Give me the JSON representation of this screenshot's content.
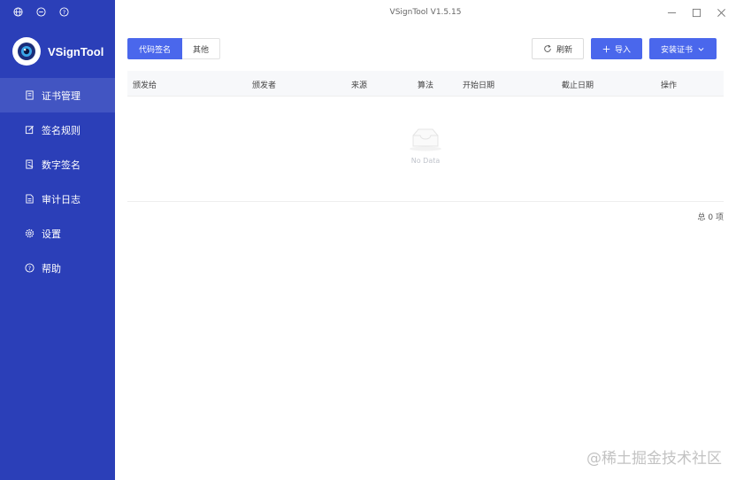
{
  "window": {
    "title": "VSignTool V1.5.15"
  },
  "sidebar": {
    "top_icons": [
      "globe-icon",
      "chat-icon",
      "help-circle-icon"
    ],
    "brand": {
      "name": "VSignTool",
      "icon": "eye-logo-icon"
    },
    "items": [
      {
        "label": "证书管理",
        "icon": "certificate-icon",
        "active": true
      },
      {
        "label": "签名规则",
        "icon": "edit-icon",
        "active": false
      },
      {
        "label": "数字签名",
        "icon": "signature-icon",
        "active": false
      },
      {
        "label": "审计日志",
        "icon": "log-icon",
        "active": false
      },
      {
        "label": "设置",
        "icon": "gear-icon",
        "active": false
      },
      {
        "label": "帮助",
        "icon": "help-icon",
        "active": false
      }
    ]
  },
  "tabs": [
    {
      "label": "代码签名",
      "active": true
    },
    {
      "label": "其他",
      "active": false
    }
  ],
  "actions": {
    "refresh_label": "刷新",
    "import_label": "导入",
    "install_label": "安装证书"
  },
  "table": {
    "columns": [
      "颁发给",
      "颁发者",
      "来源",
      "算法",
      "开始日期",
      "截止日期",
      "操作"
    ],
    "rows": [],
    "empty_text": "No Data"
  },
  "footer": {
    "total_text": "总 0 项"
  },
  "watermark": "@稀土掘金技术社区",
  "colors": {
    "sidebar_bg": "#2b3fb8",
    "sidebar_active": "#4255c2",
    "primary": "#4a67ec"
  }
}
